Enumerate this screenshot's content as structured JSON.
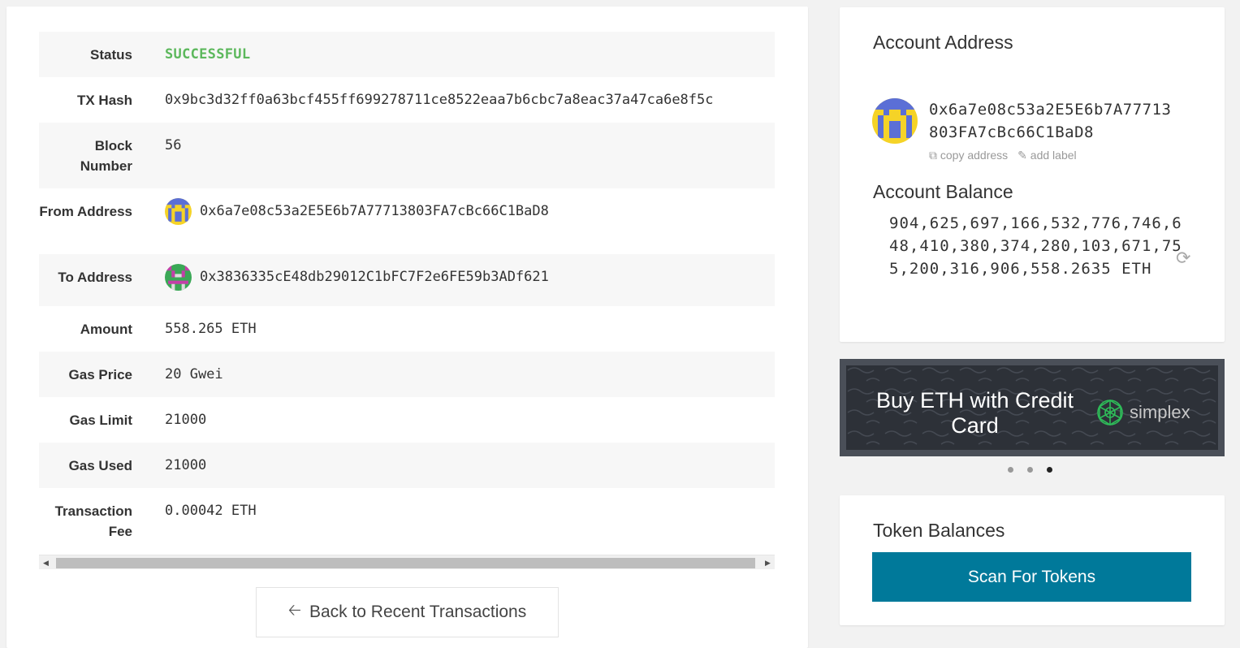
{
  "tx": {
    "rows": [
      {
        "label": "Status",
        "value": "SUCCESSFUL"
      },
      {
        "label": "TX Hash",
        "value": "0x9bc3d32ff0a63bcf455ff699278711ce8522eaa7b6cbc7a8eac37a47ca6e8f5c"
      },
      {
        "label": "Block Number",
        "value": "56"
      },
      {
        "label": "From Address",
        "value": "0x6a7e08c53a2E5E6b7A77713803FA7cBc66C1BaD8"
      },
      {
        "label": "To Address",
        "value": "0x3836335cE48db29012C1bFC7F2e6FE59b3ADf621"
      },
      {
        "label": "Amount",
        "value": "558.265 ETH"
      },
      {
        "label": "Gas Price",
        "value": "20 Gwei"
      },
      {
        "label": "Gas Limit",
        "value": "21000"
      },
      {
        "label": "Gas Used",
        "value": "21000"
      },
      {
        "label": "Transaction Fee",
        "value": "0.00042 ETH"
      }
    ],
    "back_label": "Back to Recent Transactions"
  },
  "account": {
    "title": "Account Address",
    "address": "0x6a7e08c53a2E5E6b7A77713803FA7cBc66C1BaD8",
    "copy_label": "copy address",
    "add_label": "add label",
    "balance_title": "Account Balance",
    "balance": "904,625,697,166,532,776,746,648,410,380,374,280,103,671,755,200,316,906,558.2635 ETH"
  },
  "banner": {
    "text": "Buy ETH with Credit Card",
    "brand": "simplex",
    "dots": 3,
    "active_dot": 3
  },
  "tokens": {
    "title": "Token Balances",
    "scan_label": "Scan For Tokens"
  },
  "colors": {
    "success": "#5cb85c",
    "primary_button": "#00799a",
    "banner_bg": "#2d3138"
  },
  "icons": [
    "arrow-left-icon",
    "copy-icon",
    "pencil-icon",
    "refresh-icon",
    "identicon"
  ]
}
